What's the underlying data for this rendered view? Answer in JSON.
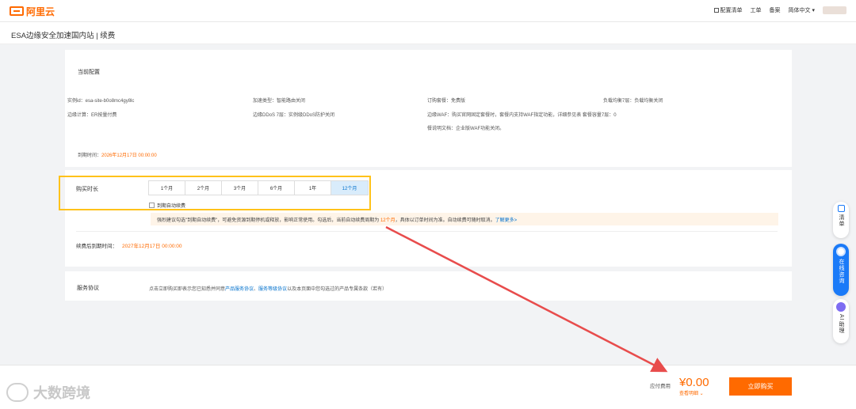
{
  "header": {
    "brand": "阿里云",
    "nav": [
      "配置清单",
      "工单",
      "备案",
      "简体中文"
    ]
  },
  "page_title": "ESA边缘安全加速国内站 | 续费",
  "current_config": {
    "title": "当前配置",
    "items": [
      "实例id：esa-site-b0o8mc4gy8lc",
      "加速类型：智能路由关闭",
      "订购套餐：免费版",
      "负载均衡7层：负载均衡关闭",
      "边缘计算：ER按量付费",
      "边缘DDoS 7层：实例级DDoS防护关闭",
      "边缘WAF：购买官网固定套餐时，套餐内支持WAF指定功能，详细参见表 套餐容量7层：0",
      "餐说明文档：企业版WAF功能关闭。"
    ],
    "expire_label": "到期时间：",
    "expire_value": "2026年12月17日 00:00:00"
  },
  "duration": {
    "label": "购买时长",
    "options": [
      "1个月",
      "2个月",
      "3个月",
      "6个月",
      "1年",
      "12个月"
    ],
    "selected": "12个月",
    "auto_renew_label": "到期自动续费",
    "notice_a": "强烈建议勾选\"到期自动续费\"，可避免资源到期停机或释放，影响正常使用。勾选后，当前自动续费周期为 ",
    "notice_period": "12个月",
    "notice_b": "，具体以订单时间为准。自动续费可随时取消。",
    "notice_link": "了解更多>",
    "after_label": "续费后到期时间：",
    "after_value": "2027年12月17日 00:00:00"
  },
  "agreement": {
    "label": "服务协议",
    "text_a": "点击立即购买即表示您已知悉并同意",
    "link1": "产品服务协议",
    "sep": "、",
    "link2": "服务等级协议",
    "text_b": "以及本页面中您勾选过的产品专属条款（若有）"
  },
  "sidebar": {
    "list": "清单",
    "online": "在线咨询",
    "ai": "AI助理"
  },
  "footer": {
    "fee_label": "应付费用",
    "fee_value": "¥0.00",
    "detail": "查看明细",
    "buy": "立即购买"
  },
  "watermark": "大数跨境",
  "colors": {
    "accent": "#ff6a00",
    "link": "#0070cc",
    "highlight": "#ffc21a",
    "arrow": "#e84c4c"
  }
}
